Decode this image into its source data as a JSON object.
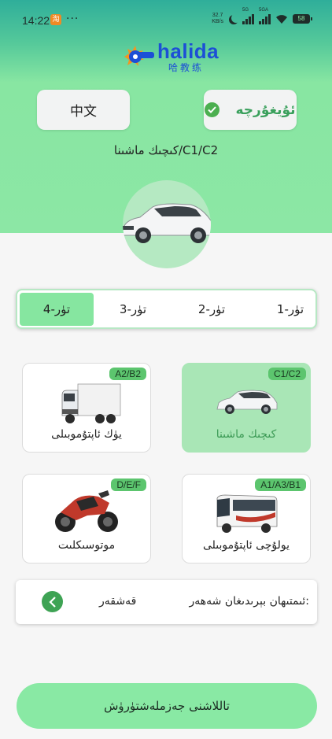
{
  "status_bar": {
    "time": "14:22",
    "dots": "···",
    "net_speed_value": "32.7",
    "net_speed_unit": "KB/s",
    "signal1_label": "5G",
    "signal2_label": "5GA",
    "battery": "58"
  },
  "logo": {
    "word": "halida",
    "sub": "哈教练"
  },
  "language": {
    "chinese": "中文",
    "uyghur": "ئۇيغۇرچە",
    "selected": "uyghur"
  },
  "license_type": "كىچىك ماشىنا/C1/C2",
  "subjects": {
    "items": [
      "1-تۈر",
      "2-تۈر",
      "3-تۈر",
      "4-تۈر"
    ],
    "active": "4-تۈر"
  },
  "vehicles": [
    {
      "badge": "C1/C2",
      "label": "كىچىك ماشىنا",
      "selected": true,
      "icon": "car-icon"
    },
    {
      "badge": "A2/B2",
      "label": "يۈك ئاپتۇموبىلى",
      "selected": false,
      "icon": "truck-icon"
    },
    {
      "badge": "A1/A3/B1",
      "label": "يولۇچى ئاپتۇموبىلى",
      "selected": false,
      "icon": "bus-icon"
    },
    {
      "badge": "D/E/F",
      "label": "موتوسىكلىت",
      "selected": false,
      "icon": "motorcycle-icon"
    }
  ],
  "city": {
    "label": "ئىمتىھان بېرىدىغان شەھەر:",
    "value": "قەشقەر",
    "icon": "chevron-left-icon"
  },
  "agree_button": "تاللاشنى جەزملەشتۈرۈش",
  "colors": {
    "accent": "#86e6a0",
    "selected_text": "#3c9a55",
    "badge": "#5cc56e"
  }
}
